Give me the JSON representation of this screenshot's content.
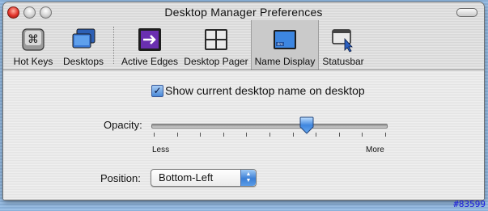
{
  "window": {
    "title": "Desktop Manager Preferences"
  },
  "toolbar": {
    "items": [
      {
        "label": "Hot Keys",
        "icon": "command-key-icon"
      },
      {
        "label": "Desktops",
        "icon": "desktops-icon"
      },
      {
        "label": "Active Edges",
        "icon": "active-edges-icon"
      },
      {
        "label": "Desktop Pager",
        "icon": "desktop-pager-icon"
      },
      {
        "label": "Name Display",
        "icon": "name-display-icon",
        "selected": true
      },
      {
        "label": "Statusbar",
        "icon": "statusbar-icon"
      }
    ]
  },
  "name_display": {
    "show_name": {
      "label": "Show current desktop name on desktop",
      "checked": true
    },
    "opacity": {
      "label": "Opacity:",
      "min_label": "Less",
      "max_label": "More",
      "value": 0.66,
      "tick_count": 11
    },
    "position": {
      "label": "Position:",
      "value": "Bottom-Left"
    }
  },
  "watermark": "#83599",
  "colors": {
    "selected_tab": "#cacaca",
    "aqua_blue": "#3b7fd6",
    "watermark": "#1a1adc"
  }
}
